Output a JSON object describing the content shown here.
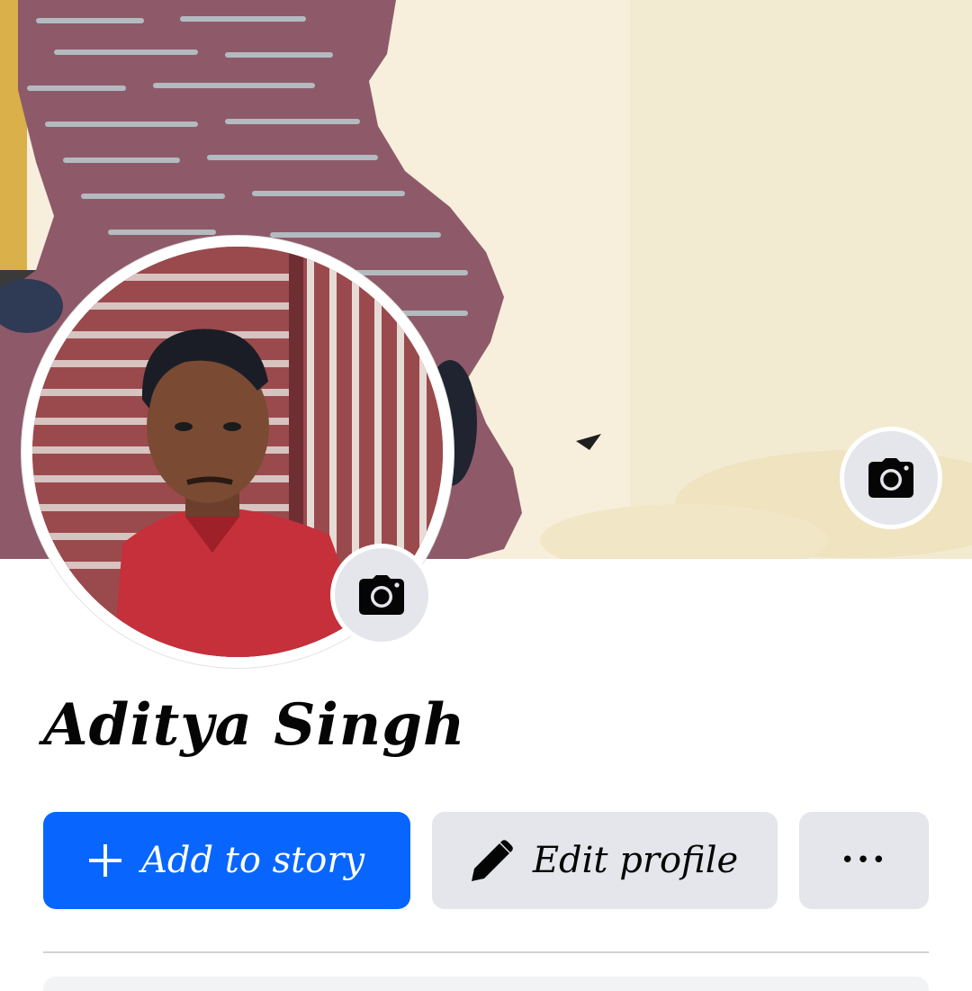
{
  "profile": {
    "name": "Aditya Singh"
  },
  "actions": {
    "add_story_label": "Add to story",
    "edit_profile_label": "Edit profile",
    "more_label": "•••"
  },
  "icons": {
    "cover_camera": "camera-icon",
    "avatar_camera": "camera-icon",
    "add": "plus-icon",
    "edit": "pencil-icon",
    "more": "ellipsis-icon"
  },
  "colors": {
    "primary_button": "#0866ff",
    "secondary_button": "#e4e6eb",
    "text": "#050505",
    "background": "#ffffff"
  }
}
